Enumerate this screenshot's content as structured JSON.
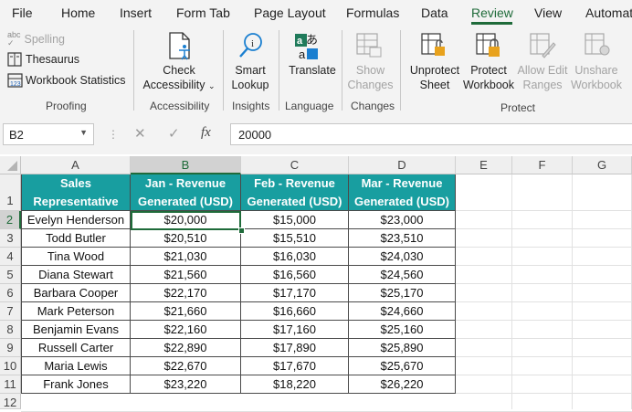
{
  "menu": {
    "tabs": [
      "File",
      "Home",
      "Insert",
      "Form Tab",
      "Page Layout",
      "Formulas",
      "Data",
      "Review",
      "View",
      "Automat"
    ],
    "active": "Review"
  },
  "ribbon": {
    "proofing": {
      "spelling": "Spelling",
      "thesaurus": "Thesaurus",
      "workbook_statistics": "Workbook Statistics",
      "group": "Proofing"
    },
    "accessibility": {
      "check_line1": "Check",
      "check_line2": "Accessibility",
      "group": "Accessibility"
    },
    "insights": {
      "smart_line1": "Smart",
      "smart_line2": "Lookup",
      "group": "Insights"
    },
    "language": {
      "translate": "Translate",
      "group": "Language"
    },
    "changes": {
      "show_line1": "Show",
      "show_line2": "Changes",
      "group": "Changes"
    },
    "protect": {
      "unprotect_line1": "Unprotect",
      "unprotect_line2": "Sheet",
      "protect_line1": "Protect",
      "protect_line2": "Workbook",
      "allow_line1": "Allow Edit",
      "allow_line2": "Ranges",
      "unshare_line1": "Unshare",
      "unshare_line2": "Workbook",
      "group": "Protect"
    }
  },
  "formula_bar": {
    "name_box": "B2",
    "fx": "fx",
    "value": "20000"
  },
  "sheet": {
    "columns": [
      "A",
      "B",
      "C",
      "D",
      "E",
      "F",
      "G"
    ],
    "rows": [
      "1",
      "2",
      "3",
      "4",
      "5",
      "6",
      "7",
      "8",
      "9",
      "10",
      "11",
      "12"
    ],
    "headers": [
      [
        "Sales",
        "Representative"
      ],
      [
        "Jan - Revenue",
        "Generated (USD)"
      ],
      [
        "Feb - Revenue",
        "Generated (USD)"
      ],
      [
        "Mar - Revenue",
        "Generated (USD)"
      ]
    ],
    "data": [
      [
        "Evelyn Henderson",
        "$20,000",
        "$15,000",
        "$23,000"
      ],
      [
        "Todd Butler",
        "$20,510",
        "$15,510",
        "$23,510"
      ],
      [
        "Tina Wood",
        "$21,030",
        "$16,030",
        "$24,030"
      ],
      [
        "Diana Stewart",
        "$21,560",
        "$16,560",
        "$24,560"
      ],
      [
        "Barbara Cooper",
        "$22,170",
        "$17,170",
        "$25,170"
      ],
      [
        "Mark Peterson",
        "$21,660",
        "$16,660",
        "$24,660"
      ],
      [
        "Benjamin Evans",
        "$22,160",
        "$17,160",
        "$25,160"
      ],
      [
        "Russell Carter",
        "$22,890",
        "$17,890",
        "$25,890"
      ],
      [
        "Maria Lewis",
        "$22,670",
        "$17,670",
        "$25,670"
      ],
      [
        "Frank Jones",
        "$23,220",
        "$18,220",
        "$26,220"
      ]
    ],
    "selected_cell": "B2"
  },
  "colors": {
    "accent": "#1f6b3a",
    "header_fill": "#189ea0"
  }
}
